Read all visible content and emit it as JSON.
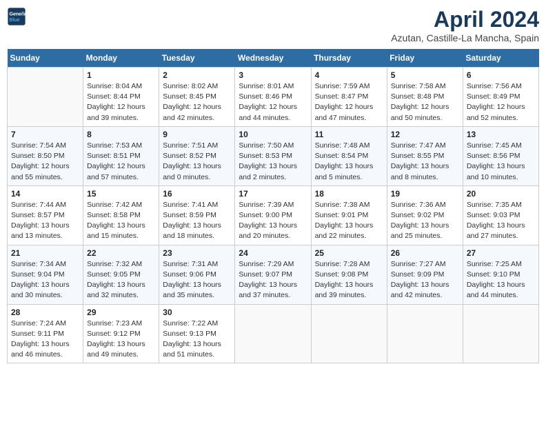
{
  "header": {
    "logo_line1": "General",
    "logo_line2": "Blue",
    "title": "April 2024",
    "subtitle": "Azutan, Castille-La Mancha, Spain"
  },
  "weekdays": [
    "Sunday",
    "Monday",
    "Tuesday",
    "Wednesday",
    "Thursday",
    "Friday",
    "Saturday"
  ],
  "weeks": [
    [
      {
        "num": "",
        "info": ""
      },
      {
        "num": "1",
        "info": "Sunrise: 8:04 AM\nSunset: 8:44 PM\nDaylight: 12 hours\nand 39 minutes."
      },
      {
        "num": "2",
        "info": "Sunrise: 8:02 AM\nSunset: 8:45 PM\nDaylight: 12 hours\nand 42 minutes."
      },
      {
        "num": "3",
        "info": "Sunrise: 8:01 AM\nSunset: 8:46 PM\nDaylight: 12 hours\nand 44 minutes."
      },
      {
        "num": "4",
        "info": "Sunrise: 7:59 AM\nSunset: 8:47 PM\nDaylight: 12 hours\nand 47 minutes."
      },
      {
        "num": "5",
        "info": "Sunrise: 7:58 AM\nSunset: 8:48 PM\nDaylight: 12 hours\nand 50 minutes."
      },
      {
        "num": "6",
        "info": "Sunrise: 7:56 AM\nSunset: 8:49 PM\nDaylight: 12 hours\nand 52 minutes."
      }
    ],
    [
      {
        "num": "7",
        "info": "Sunrise: 7:54 AM\nSunset: 8:50 PM\nDaylight: 12 hours\nand 55 minutes."
      },
      {
        "num": "8",
        "info": "Sunrise: 7:53 AM\nSunset: 8:51 PM\nDaylight: 12 hours\nand 57 minutes."
      },
      {
        "num": "9",
        "info": "Sunrise: 7:51 AM\nSunset: 8:52 PM\nDaylight: 13 hours\nand 0 minutes."
      },
      {
        "num": "10",
        "info": "Sunrise: 7:50 AM\nSunset: 8:53 PM\nDaylight: 13 hours\nand 2 minutes."
      },
      {
        "num": "11",
        "info": "Sunrise: 7:48 AM\nSunset: 8:54 PM\nDaylight: 13 hours\nand 5 minutes."
      },
      {
        "num": "12",
        "info": "Sunrise: 7:47 AM\nSunset: 8:55 PM\nDaylight: 13 hours\nand 8 minutes."
      },
      {
        "num": "13",
        "info": "Sunrise: 7:45 AM\nSunset: 8:56 PM\nDaylight: 13 hours\nand 10 minutes."
      }
    ],
    [
      {
        "num": "14",
        "info": "Sunrise: 7:44 AM\nSunset: 8:57 PM\nDaylight: 13 hours\nand 13 minutes."
      },
      {
        "num": "15",
        "info": "Sunrise: 7:42 AM\nSunset: 8:58 PM\nDaylight: 13 hours\nand 15 minutes."
      },
      {
        "num": "16",
        "info": "Sunrise: 7:41 AM\nSunset: 8:59 PM\nDaylight: 13 hours\nand 18 minutes."
      },
      {
        "num": "17",
        "info": "Sunrise: 7:39 AM\nSunset: 9:00 PM\nDaylight: 13 hours\nand 20 minutes."
      },
      {
        "num": "18",
        "info": "Sunrise: 7:38 AM\nSunset: 9:01 PM\nDaylight: 13 hours\nand 22 minutes."
      },
      {
        "num": "19",
        "info": "Sunrise: 7:36 AM\nSunset: 9:02 PM\nDaylight: 13 hours\nand 25 minutes."
      },
      {
        "num": "20",
        "info": "Sunrise: 7:35 AM\nSunset: 9:03 PM\nDaylight: 13 hours\nand 27 minutes."
      }
    ],
    [
      {
        "num": "21",
        "info": "Sunrise: 7:34 AM\nSunset: 9:04 PM\nDaylight: 13 hours\nand 30 minutes."
      },
      {
        "num": "22",
        "info": "Sunrise: 7:32 AM\nSunset: 9:05 PM\nDaylight: 13 hours\nand 32 minutes."
      },
      {
        "num": "23",
        "info": "Sunrise: 7:31 AM\nSunset: 9:06 PM\nDaylight: 13 hours\nand 35 minutes."
      },
      {
        "num": "24",
        "info": "Sunrise: 7:29 AM\nSunset: 9:07 PM\nDaylight: 13 hours\nand 37 minutes."
      },
      {
        "num": "25",
        "info": "Sunrise: 7:28 AM\nSunset: 9:08 PM\nDaylight: 13 hours\nand 39 minutes."
      },
      {
        "num": "26",
        "info": "Sunrise: 7:27 AM\nSunset: 9:09 PM\nDaylight: 13 hours\nand 42 minutes."
      },
      {
        "num": "27",
        "info": "Sunrise: 7:25 AM\nSunset: 9:10 PM\nDaylight: 13 hours\nand 44 minutes."
      }
    ],
    [
      {
        "num": "28",
        "info": "Sunrise: 7:24 AM\nSunset: 9:11 PM\nDaylight: 13 hours\nand 46 minutes."
      },
      {
        "num": "29",
        "info": "Sunrise: 7:23 AM\nSunset: 9:12 PM\nDaylight: 13 hours\nand 49 minutes."
      },
      {
        "num": "30",
        "info": "Sunrise: 7:22 AM\nSunset: 9:13 PM\nDaylight: 13 hours\nand 51 minutes."
      },
      {
        "num": "",
        "info": ""
      },
      {
        "num": "",
        "info": ""
      },
      {
        "num": "",
        "info": ""
      },
      {
        "num": "",
        "info": ""
      }
    ]
  ]
}
